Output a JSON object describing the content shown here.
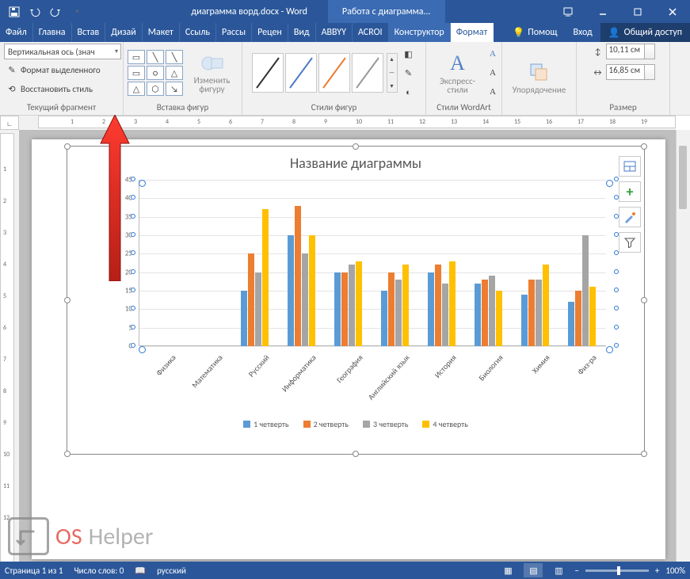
{
  "titlebar": {
    "doc_title": "диаграмма ворд.docx - Word",
    "tools_context": "Работа с диаграмма..."
  },
  "tabs": {
    "file": "Файл",
    "items": [
      "Главна",
      "Встав",
      "Дизай",
      "Макет",
      "Ссыль",
      "Рассы",
      "Рецен",
      "Вид",
      "ABBYY",
      "ACROI"
    ],
    "context": [
      "Конструктор",
      "Формат"
    ],
    "help": "Помощ",
    "signin": "Вход",
    "share": "Общий доступ"
  },
  "ribbon": {
    "g1_combo": "Вертикальная ось (знач",
    "g1_b2": "Формат выделенного",
    "g1_b3": "Восстановить стиль",
    "g1_label": "Текущий фрагмент",
    "g2_changeshape": "Изменить фигуру",
    "g2_label": "Вставка фигур",
    "g3_label": "Стили фигур",
    "g4_express": "Экспресс-стили",
    "g4_label": "Стили WordArt",
    "g5_label": "Упорядочение",
    "g6_h": "10,11 см",
    "g6_w": "16,85 см",
    "g6_label": "Размер"
  },
  "chart_data": {
    "type": "bar",
    "title": "Название диаграммы",
    "ylim": [
      0,
      45
    ],
    "yticks": [
      0,
      5,
      10,
      15,
      20,
      25,
      30,
      35,
      40,
      45
    ],
    "categories": [
      "Физика",
      "Математика",
      "Русский",
      "Информатика",
      "География",
      "Английский язык",
      "История",
      "Биология",
      "Химия",
      "Физ-ра"
    ],
    "series": [
      {
        "name": "1 четверть",
        "color": "#5b9bd5",
        "values": [
          null,
          null,
          15,
          30,
          20,
          15,
          20,
          17,
          14,
          12
        ]
      },
      {
        "name": "2 четверть",
        "color": "#ed7d31",
        "values": [
          null,
          null,
          25,
          38,
          20,
          20,
          22,
          18,
          18,
          15
        ]
      },
      {
        "name": "3 четверть",
        "color": "#a5a5a5",
        "values": [
          null,
          null,
          20,
          25,
          22,
          18,
          17,
          19,
          18,
          30
        ]
      },
      {
        "name": "4 четверть",
        "color": "#ffc000",
        "values": [
          null,
          null,
          37,
          30,
          23,
          22,
          23,
          15,
          22,
          16
        ]
      }
    ]
  },
  "status": {
    "page": "Страница 1 из 1",
    "words": "Число слов: 0",
    "lang": "русский",
    "zoom": "100%"
  },
  "watermark": {
    "text1": "OS",
    "text2": "Helper"
  }
}
